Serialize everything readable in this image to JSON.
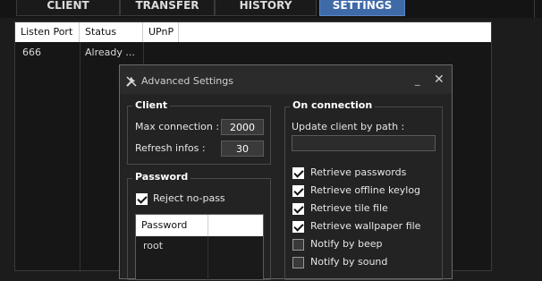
{
  "tabs": [
    {
      "label": "CLIENT",
      "active": false
    },
    {
      "label": "TRANSFER",
      "active": false
    },
    {
      "label": "HISTORY",
      "active": false
    },
    {
      "label": "SETTINGS",
      "active": true
    }
  ],
  "listview": {
    "columns": [
      "Listen Port",
      "Status",
      "UPnP"
    ],
    "rows": [
      {
        "port": "666",
        "status": "Already ..."
      }
    ]
  },
  "dialog": {
    "title": "Advanced Settings",
    "minimize_glyph": "_",
    "close_glyph": "✕",
    "icon": "tools-icon",
    "client_group": {
      "title": "Client",
      "max_connection_label": "Max connection :",
      "max_connection_value": "2000",
      "refresh_infos_label": "Refresh infos :",
      "refresh_infos_value": "30"
    },
    "password_group": {
      "title": "Password",
      "reject_nopass_label": "Reject no-pass",
      "reject_nopass_checked": true,
      "list_header": "Password",
      "entries": [
        "root"
      ]
    },
    "connection_group": {
      "title": "On connection",
      "update_path_label": "Update client by path :",
      "update_path_value": "",
      "options": [
        {
          "label": "Retrieve passwords",
          "checked": true
        },
        {
          "label": "Retrieve offline keylog",
          "checked": true
        },
        {
          "label": "Retrieve tile file",
          "checked": true
        },
        {
          "label": "Retrieve wallpaper file",
          "checked": true
        },
        {
          "label": "Notify by beep",
          "checked": false
        },
        {
          "label": "Notify by sound",
          "checked": false
        }
      ]
    }
  },
  "colors": {
    "active_tab": "#3f6aa8",
    "background": "#1c1c1c",
    "dialog_bg": "#232323"
  }
}
